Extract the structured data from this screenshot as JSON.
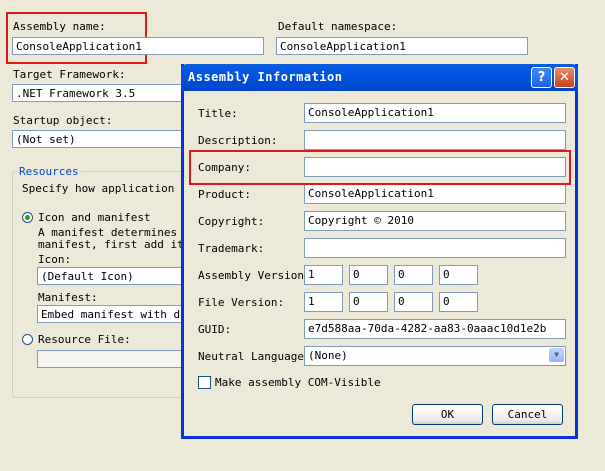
{
  "background": {
    "assembly_name_label": "Assembly name:",
    "assembly_name_value": "ConsoleApplication1",
    "default_namespace_label": "Default namespace:",
    "default_namespace_value": "ConsoleApplication1",
    "target_framework_label": "Target Framework:",
    "target_framework_value": ".NET Framework 3.5",
    "startup_object_label": "Startup object:",
    "startup_object_value": "(Not set)",
    "resources_label": "Resources",
    "resources_desc": "Specify how application re",
    "icon_manifest_label": "Icon and manifest",
    "manifest_text_1": "A manifest determines sp",
    "manifest_text_2": "manifest, first add it t",
    "icon_label": "Icon:",
    "icon_value": "(Default Icon)",
    "manifest_label": "Manifest:",
    "manifest_value": "Embed manifest with defa",
    "resource_file_label": "Resource File:"
  },
  "dialog": {
    "title": "Assembly Information",
    "help_glyph": "?",
    "close_glyph": "✕",
    "fields": {
      "title_label": "Title:",
      "title_value": "ConsoleApplication1",
      "description_label": "Description:",
      "description_value": "",
      "company_label": "Company:",
      "company_value": "",
      "product_label": "Product:",
      "product_value": "ConsoleApplication1",
      "copyright_label": "Copyright:",
      "copyright_value": "Copyright ©  2010",
      "trademark_label": "Trademark:",
      "trademark_value": "",
      "assembly_version_label": "Assembly Version:",
      "assembly_version": [
        "1",
        "0",
        "0",
        "0"
      ],
      "file_version_label": "File Version:",
      "file_version": [
        "1",
        "0",
        "0",
        "0"
      ],
      "guid_label": "GUID:",
      "guid_value": "e7d588aa-70da-4282-aa83-0aaac10d1e2b",
      "neutral_language_label": "Neutral Language:",
      "neutral_language_value": "(None)"
    },
    "com_visible_label": "Make assembly COM-Visible",
    "com_visible_checked": false,
    "ok_label": "OK",
    "cancel_label": "Cancel"
  },
  "highlight_color": "#e01a1a",
  "accent_color": "#0054e3"
}
